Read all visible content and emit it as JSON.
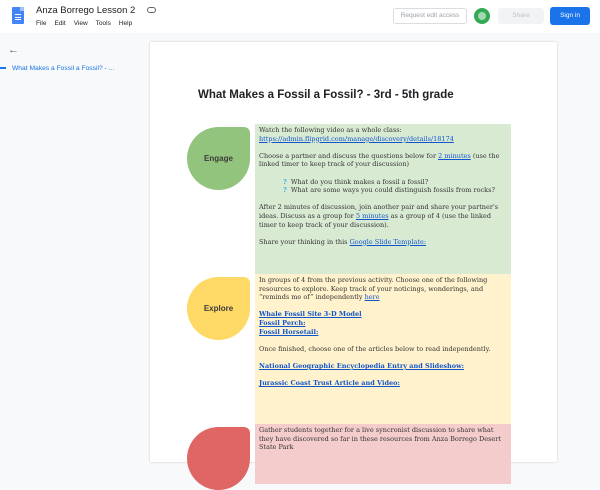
{
  "app": {
    "title": "Anza Borrego Lesson 2",
    "menu": [
      "File",
      "Edit",
      "View",
      "Tools",
      "Help"
    ],
    "request_edit": "Request edit access",
    "share": "Share",
    "sign_in": "Sign in"
  },
  "outline": {
    "item": "What Makes a Fossil a Fossil? - ..."
  },
  "doc": {
    "title": "What Makes a Fossil a Fossil? - 3rd - 5th grade",
    "engage": {
      "label": "Engage",
      "color": "#93c47d",
      "bg": "#d9ead3",
      "p1": "Watch the following video as a whole class:",
      "link1": "https://admin.flipgrid.com/manage/discovery/details/18174",
      "p2a": "Choose a partner and discuss the questions below for ",
      "p2link": "2 minutes",
      "p2b": " (use the linked timer to keep track of your discussion)",
      "q1": "What do you think makes a fossil a fossil?",
      "q2": "What are some ways you could distinguish fossils from rocks?",
      "p3a": "After 2 minutes of discussion, join another pair and share your partner's ideas.  Discuss as a group for ",
      "p3link": "5 minutes",
      "p3b": " as a group of 4 (use the linked timer to keep track of your discussion).",
      "p4a": "Share your thinking in this ",
      "p4link": "Google Slide Template:"
    },
    "explore": {
      "label": "Explore",
      "color": "#ffd966",
      "bg": "#fff2cc",
      "p1a": "In groups of 4 from the previous activity.  Choose one of the following resources to explore.  Keep track of your noticings, wonderings, and “reminds me of” independently ",
      "p1link": "here",
      "r1": "Whale Fossil Site 3-D Model",
      "r2": "Fossil Perch:",
      "r3": "Fossil Horsetail:",
      "p2": "Once finished, choose one of the articles below to read independently.",
      "a1": "National Geographic Encyclopedia Entry and Slideshow:",
      "a2": "Jurassic Coast Trust Article and Video:"
    },
    "explain": {
      "color": "#e06666",
      "bg": "#f4cccc",
      "p1": "Gather students together for a live syncronist discussion to share what they have discovered so far in these resources from Anza Borrego Desert State Park"
    }
  }
}
